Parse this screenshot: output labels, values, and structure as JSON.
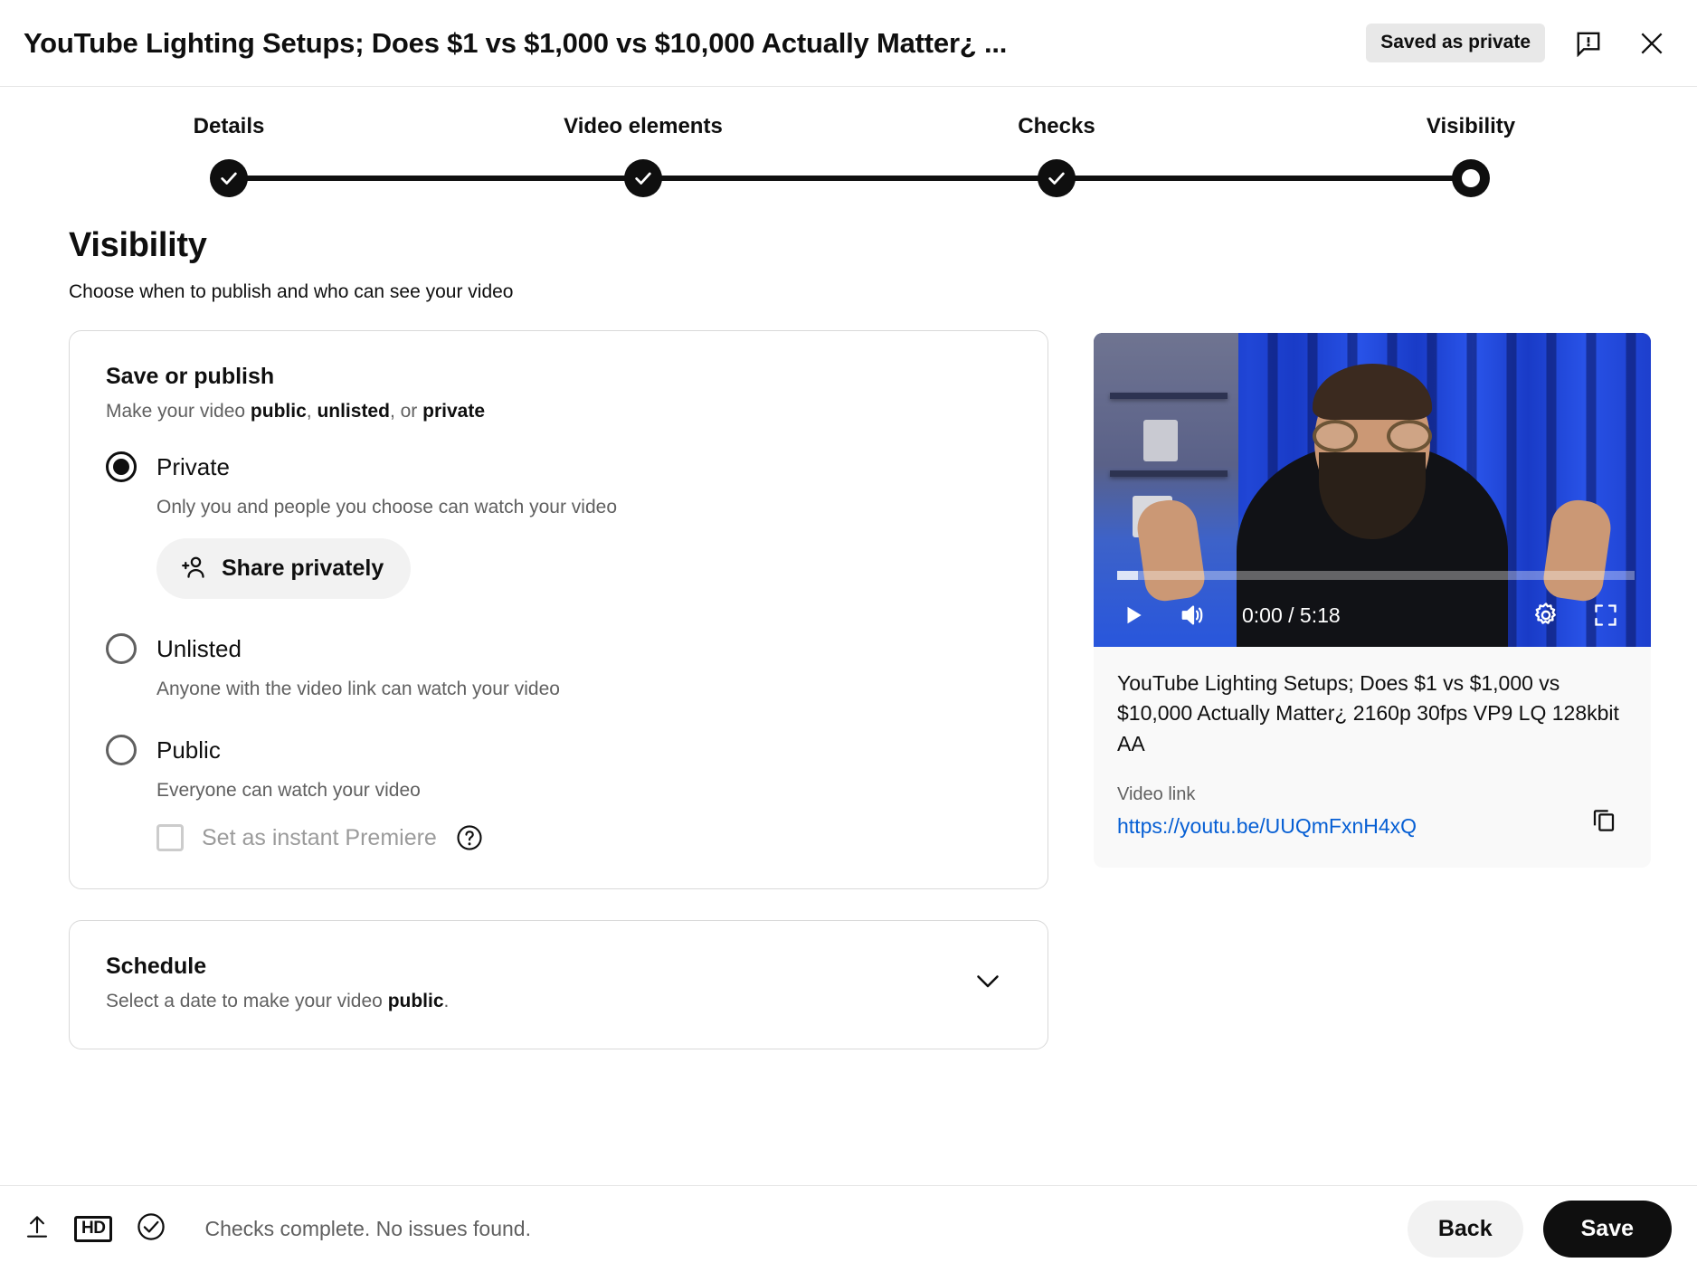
{
  "header": {
    "title": "YouTube Lighting Setups; Does $1 vs $1,000 vs $10,000 Actually Matter¿ ...",
    "saved_chip": "Saved as private",
    "feedback_icon": "feedback-bubble-icon",
    "close_icon": "close-icon"
  },
  "stepper": {
    "steps": [
      {
        "label": "Details",
        "state": "complete"
      },
      {
        "label": "Video elements",
        "state": "complete"
      },
      {
        "label": "Checks",
        "state": "complete"
      },
      {
        "label": "Visibility",
        "state": "current"
      }
    ]
  },
  "section": {
    "title": "Visibility",
    "subtitle": "Choose when to publish and who can see your video"
  },
  "publish_card": {
    "title": "Save or publish",
    "subtitle_parts": {
      "lead": "Make your video ",
      "b1": "public",
      "sep1": ", ",
      "b2": "unlisted",
      "sep2": ", or ",
      "b3": "private"
    },
    "options": [
      {
        "label": "Private",
        "description": "Only you and people you choose can watch your video",
        "selected": true
      },
      {
        "label": "Unlisted",
        "description": "Anyone with the video link can watch your video",
        "selected": false
      },
      {
        "label": "Public",
        "description": "Everyone can watch your video",
        "selected": false
      }
    ],
    "share_button": {
      "label": "Share privately",
      "icon": "person-add-icon"
    },
    "premiere": {
      "label": "Set as instant Premiere",
      "checked": false,
      "disabled": true,
      "help_icon": "help-circle-icon"
    }
  },
  "schedule_card": {
    "title": "Schedule",
    "sub_lead": "Select a date to make your video ",
    "sub_bold": "public",
    "sub_tail": ".",
    "chevron_icon": "chevron-down-icon"
  },
  "preview": {
    "player": {
      "play_icon": "play-icon",
      "volume_icon": "volume-icon",
      "time": "0:00 / 5:18",
      "settings_icon": "gear-icon",
      "fullscreen_icon": "fullscreen-icon",
      "progress_percent": 0
    },
    "video_title": "YouTube Lighting Setups; Does $1 vs $1,000 vs $10,000 Actually Matter¿ 2160p 30fps VP9 LQ 128kbit AA",
    "link_caption": "Video link",
    "link_url": "https://youtu.be/UUQmFxnH4xQ",
    "copy_icon": "copy-icon",
    "link_color": "#065fd4"
  },
  "footer": {
    "upload_icon": "upload-icon",
    "hd_badge": "HD",
    "check_icon": "check-circle-icon",
    "status": "Checks complete. No issues found.",
    "back_label": "Back",
    "save_label": "Save"
  }
}
